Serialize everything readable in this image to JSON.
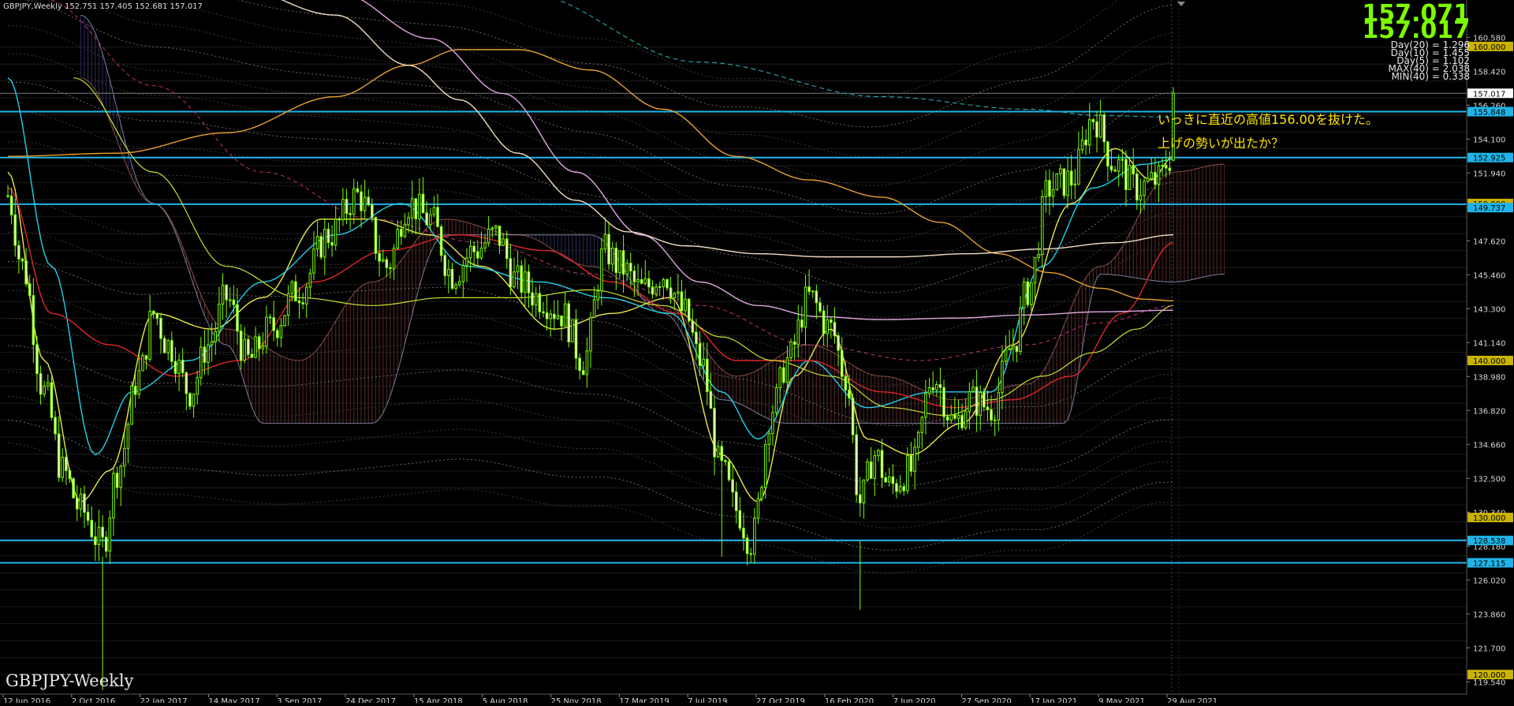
{
  "header": {
    "title": "GBPJPY,Weekly  152.751 157.405 152.681 157.017"
  },
  "prices": {
    "bid": "157.071",
    "ask": "157.017"
  },
  "stats": [
    "Day(20) = 1.296",
    "Day(10) = 1.455",
    "Day(5) = 1.102",
    "MAX(40) = 2.038",
    "MIN(40) = 0.338"
  ],
  "watermark": "GBPJPY-Weekly",
  "annotations": [
    "いっきに直近の高値156.00を抜けた。",
    "上げの勢いが出たか？"
  ],
  "colors": {
    "background": "#000000",
    "candle": "#7cfc00",
    "candle_body": "#f2ffd0",
    "level_line": "#1fb4e8",
    "annotation_text": "#ffe400",
    "price_label_bg": "#c9b300"
  },
  "chart_data": {
    "type": "candlestick",
    "title": "GBPJPY-Weekly",
    "symbol": "GBPJPY",
    "timeframe": "Weekly",
    "ylim": [
      118.5,
      162.0
    ],
    "grid": false,
    "x_ticks": [
      "12 Jun 2016",
      "2 Oct 2016",
      "22 Jan 2017",
      "14 May 2017",
      "3 Sep 2017",
      "24 Dec 2017",
      "15 Apr 2018",
      "5 Aug 2018",
      "25 Nov 2018",
      "17 Mar 2019",
      "7 Jul 2019",
      "27 Oct 2019",
      "16 Feb 2020",
      "7 Jun 2020",
      "27 Sep 2020",
      "17 Jan 2021",
      "9 May 2021",
      "29 Aug 2021"
    ],
    "y_ticks": [
      "160.580",
      "158.420",
      "156.260",
      "154.100",
      "151.940",
      "149.780",
      "147.620",
      "145.460",
      "143.300",
      "141.140",
      "138.980",
      "136.820",
      "134.660",
      "132.500",
      "130.340",
      "128.180",
      "126.020",
      "123.860",
      "121.700",
      "119.540"
    ],
    "price_labels": [
      {
        "text": "160.000",
        "value": 160.0,
        "style": "gold"
      },
      {
        "text": "157.017",
        "value": 157.017,
        "style": "white"
      },
      {
        "text": "155.848",
        "value": 155.848,
        "style": "blue"
      },
      {
        "text": "152.925",
        "value": 152.925,
        "style": "blue"
      },
      {
        "text": "150.000",
        "value": 150.0,
        "style": "gold"
      },
      {
        "text": "149.737",
        "value": 149.737,
        "style": "blue"
      },
      {
        "text": "140.000",
        "value": 140.0,
        "style": "gold"
      },
      {
        "text": "130.000",
        "value": 130.0,
        "style": "gold"
      },
      {
        "text": "128.538",
        "value": 128.538,
        "style": "blue"
      },
      {
        "text": "127.115",
        "value": 127.115,
        "style": "blue"
      },
      {
        "text": "120.000",
        "value": 120.0,
        "style": "gold"
      }
    ],
    "horizontal_levels": [
      155.848,
      152.925,
      149.95,
      128.538,
      127.115
    ],
    "last_close": 157.017,
    "anchors": [
      [
        0,
        150.5
      ],
      [
        4,
        146
      ],
      [
        10,
        138
      ],
      [
        15,
        133
      ],
      [
        20,
        130.5
      ],
      [
        26,
        128.2
      ],
      [
        30,
        133
      ],
      [
        36,
        139
      ],
      [
        40,
        143
      ],
      [
        44,
        141
      ],
      [
        50,
        138
      ],
      [
        55,
        141
      ],
      [
        60,
        144
      ],
      [
        66,
        140
      ],
      [
        72,
        142
      ],
      [
        80,
        144.5
      ],
      [
        88,
        148
      ],
      [
        96,
        150.5
      ],
      [
        104,
        146
      ],
      [
        110,
        150
      ],
      [
        116,
        149
      ],
      [
        122,
        145.5
      ],
      [
        128,
        147
      ],
      [
        134,
        148
      ],
      [
        140,
        145
      ],
      [
        146,
        144
      ],
      [
        152,
        143
      ],
      [
        158,
        140
      ],
      [
        164,
        147
      ],
      [
        168,
        146
      ],
      [
        174,
        144.5
      ],
      [
        180,
        145.5
      ],
      [
        186,
        143
      ],
      [
        190,
        140
      ],
      [
        196,
        133
      ],
      [
        200,
        130.5
      ],
      [
        204,
        128.5
      ],
      [
        210,
        137
      ],
      [
        214,
        140
      ],
      [
        220,
        144
      ],
      [
        226,
        142
      ],
      [
        230,
        139
      ],
      [
        234,
        131
      ],
      [
        238,
        134
      ],
      [
        242,
        132
      ],
      [
        248,
        133
      ],
      [
        254,
        139
      ],
      [
        260,
        136
      ],
      [
        264,
        137.5
      ],
      [
        270,
        137
      ],
      [
        276,
        141
      ],
      [
        280,
        144.5
      ],
      [
        286,
        151
      ],
      [
        292,
        151.5
      ],
      [
        298,
        155.5
      ],
      [
        304,
        152.5
      ],
      [
        310,
        151
      ],
      [
        316,
        151.5
      ],
      [
        319,
        152.9
      ],
      [
        320,
        157.0
      ]
    ],
    "overlays": [
      {
        "name": "MA-yellow",
        "color": "#e8e84a",
        "width": 1.4,
        "points": [
          [
            0,
            152
          ],
          [
            10,
            140
          ],
          [
            20,
            131
          ],
          [
            28,
            133
          ],
          [
            40,
            143
          ],
          [
            56,
            142
          ],
          [
            70,
            144
          ],
          [
            86,
            149
          ],
          [
            100,
            149
          ],
          [
            116,
            148
          ],
          [
            130,
            146
          ],
          [
            150,
            142
          ],
          [
            166,
            143
          ],
          [
            182,
            144
          ],
          [
            196,
            134
          ],
          [
            206,
            131
          ],
          [
            216,
            139
          ],
          [
            226,
            142
          ],
          [
            236,
            135
          ],
          [
            248,
            134
          ],
          [
            262,
            136
          ],
          [
            276,
            141
          ],
          [
            292,
            150
          ],
          [
            304,
            153.5
          ],
          [
            314,
            151.5
          ],
          [
            320,
            153
          ]
        ]
      },
      {
        "name": "MA-cyan",
        "color": "#20d0e8",
        "width": 1.4,
        "points": [
          [
            0,
            158
          ],
          [
            12,
            146
          ],
          [
            24,
            134
          ],
          [
            34,
            138
          ],
          [
            50,
            140
          ],
          [
            70,
            145
          ],
          [
            90,
            148
          ],
          [
            108,
            150
          ],
          [
            126,
            146
          ],
          [
            146,
            145
          ],
          [
            164,
            144
          ],
          [
            182,
            143
          ],
          [
            196,
            138
          ],
          [
            206,
            135
          ],
          [
            220,
            140
          ],
          [
            236,
            137
          ],
          [
            254,
            138
          ],
          [
            270,
            138
          ],
          [
            284,
            146
          ],
          [
            298,
            151
          ],
          [
            312,
            152.5
          ],
          [
            320,
            152.8
          ]
        ]
      },
      {
        "name": "MA-red",
        "color": "#e0262a",
        "width": 1.4,
        "points": [
          [
            0,
            151
          ],
          [
            12,
            143
          ],
          [
            28,
            141
          ],
          [
            46,
            139
          ],
          [
            64,
            140
          ],
          [
            84,
            145
          ],
          [
            104,
            147
          ],
          [
            124,
            148
          ],
          [
            148,
            147
          ],
          [
            166,
            145
          ],
          [
            184,
            143
          ],
          [
            200,
            140
          ],
          [
            220,
            140
          ],
          [
            240,
            138
          ],
          [
            260,
            137
          ],
          [
            276,
            137.5
          ],
          [
            292,
            139
          ],
          [
            306,
            143
          ],
          [
            320,
            147.5
          ]
        ]
      },
      {
        "name": "MA-lime",
        "color": "#c8e030",
        "width": 1.2,
        "points": [
          [
            18,
            158
          ],
          [
            40,
            152
          ],
          [
            60,
            146
          ],
          [
            80,
            144
          ],
          [
            100,
            143.5
          ],
          [
            120,
            144
          ],
          [
            140,
            144
          ],
          [
            160,
            144.5
          ],
          [
            180,
            143.5
          ],
          [
            196,
            141.5
          ],
          [
            210,
            140
          ],
          [
            226,
            139
          ],
          [
            242,
            137
          ],
          [
            258,
            136.5
          ],
          [
            270,
            137.5
          ],
          [
            284,
            139
          ],
          [
            298,
            140.5
          ],
          [
            310,
            142
          ],
          [
            320,
            143.5
          ]
        ]
      },
      {
        "name": "MA-orange",
        "color": "#e8a030",
        "width": 1.4,
        "points": [
          [
            0,
            153
          ],
          [
            30,
            153.2
          ],
          [
            60,
            154.5
          ],
          [
            90,
            156.8
          ],
          [
            110,
            158.8
          ],
          [
            124,
            159.8
          ],
          [
            140,
            159.8
          ],
          [
            160,
            158.5
          ],
          [
            180,
            156
          ],
          [
            200,
            153
          ],
          [
            220,
            151.5
          ],
          [
            240,
            150.4
          ],
          [
            256,
            148.8
          ],
          [
            272,
            146.8
          ],
          [
            286,
            145.6
          ],
          [
            300,
            144.6
          ],
          [
            312,
            143.9
          ],
          [
            320,
            143.8
          ]
        ]
      },
      {
        "name": "MA-pink",
        "color": "#e0a8e0",
        "width": 1.4,
        "points": [
          [
            60,
            165
          ],
          [
            90,
            163.5
          ],
          [
            116,
            160.5
          ],
          [
            136,
            157
          ],
          [
            156,
            152
          ],
          [
            174,
            148
          ],
          [
            190,
            145
          ],
          [
            206,
            143.5
          ],
          [
            222,
            142.8
          ],
          [
            240,
            142.6
          ],
          [
            260,
            142.7
          ],
          [
            280,
            142.9
          ],
          [
            300,
            143.1
          ],
          [
            320,
            143.2
          ]
        ]
      },
      {
        "name": "MA-beige",
        "color": "#f0dcc0",
        "width": 1.4,
        "points": [
          [
            60,
            164
          ],
          [
            90,
            162
          ],
          [
            110,
            158.8
          ],
          [
            124,
            156.6
          ],
          [
            140,
            153.2
          ],
          [
            156,
            150.2
          ],
          [
            170,
            148.2
          ],
          [
            186,
            147.3
          ],
          [
            206,
            146.8
          ],
          [
            224,
            146.6
          ],
          [
            244,
            146.6
          ],
          [
            264,
            146.8
          ],
          [
            284,
            147.1
          ],
          [
            304,
            147.5
          ],
          [
            320,
            148
          ]
        ]
      },
      {
        "name": "MA-teal-dash",
        "color": "#2aa8b0",
        "width": 1.1,
        "dash": "6 4",
        "points": [
          [
            90,
            167
          ],
          [
            140,
            163.5
          ],
          [
            190,
            159
          ],
          [
            240,
            156.8
          ],
          [
            280,
            156
          ],
          [
            300,
            155.6
          ],
          [
            320,
            155.5
          ]
        ]
      },
      {
        "name": "MA-magenta-dash",
        "color": "#c03080",
        "width": 1.0,
        "dash": "5 4",
        "points": [
          [
            10,
            163
          ],
          [
            40,
            157.5
          ],
          [
            70,
            152
          ],
          [
            100,
            149
          ],
          [
            130,
            147.5
          ],
          [
            160,
            145.5
          ],
          [
            190,
            143.5
          ],
          [
            220,
            141
          ],
          [
            250,
            140
          ],
          [
            280,
            141
          ],
          [
            300,
            142.4
          ],
          [
            320,
            143.5
          ]
        ]
      }
    ]
  }
}
